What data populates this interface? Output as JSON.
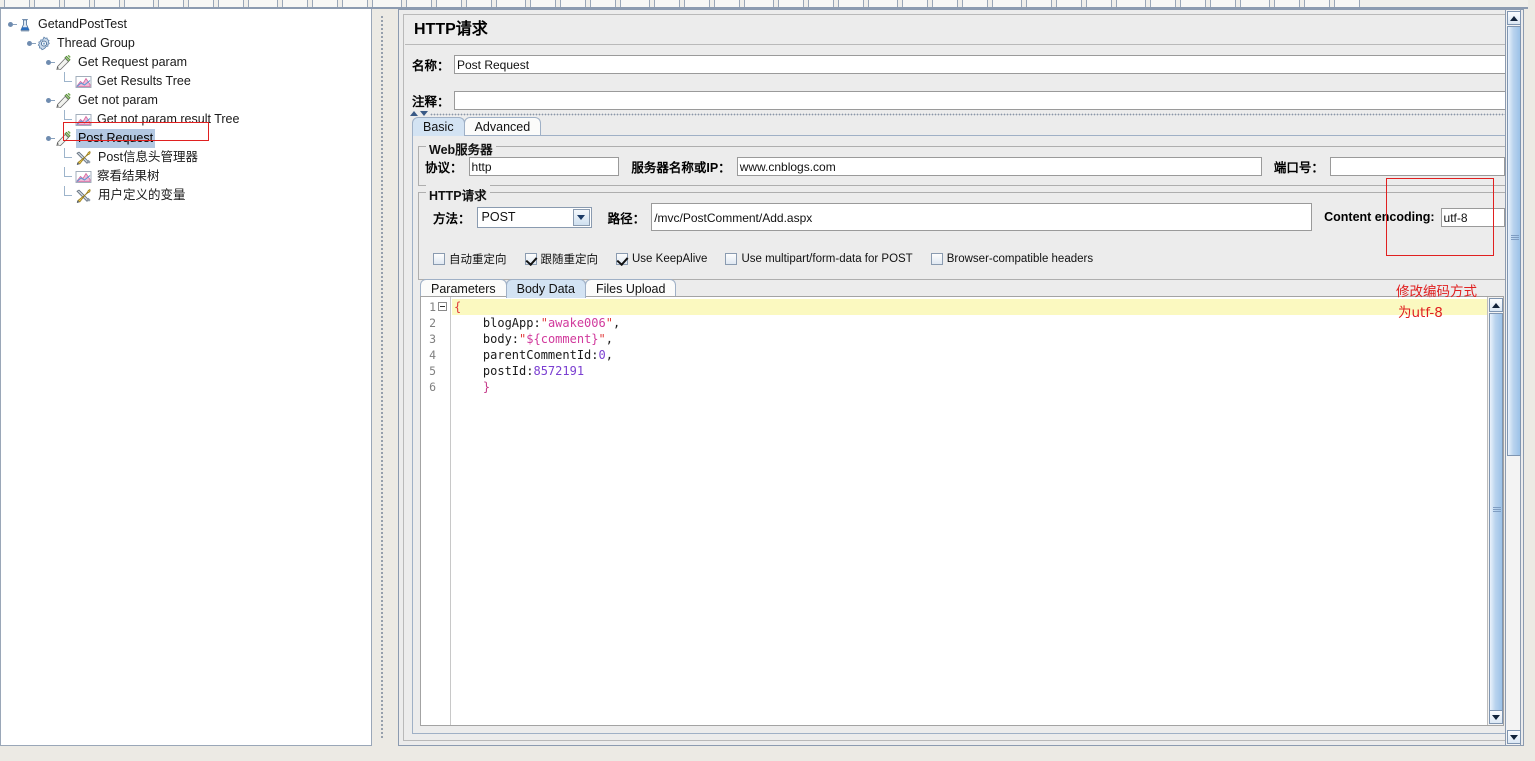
{
  "tree": {
    "name": "test-plan-tree",
    "nodes": [
      {
        "label": "GetandPostTest",
        "icon": "test-plan-icon",
        "depth": 0,
        "selected": false
      },
      {
        "label": "Thread Group",
        "icon": "thread-group-icon",
        "depth": 1,
        "selected": false
      },
      {
        "label": "Get Request param",
        "icon": "http-sampler-icon",
        "depth": 2,
        "selected": false
      },
      {
        "label": "Get Results Tree",
        "icon": "listener-icon",
        "depth": 3,
        "selected": false
      },
      {
        "label": "Get not param",
        "icon": "http-sampler-icon",
        "depth": 2,
        "selected": false
      },
      {
        "label": "Get not param result Tree",
        "icon": "listener-icon",
        "depth": 3,
        "selected": false
      },
      {
        "label": "Post Request",
        "icon": "http-sampler-icon",
        "depth": 2,
        "selected": true
      },
      {
        "label": "Post信息头管理器",
        "icon": "config-icon",
        "depth": 3,
        "selected": false
      },
      {
        "label": "察看结果树",
        "icon": "listener-icon",
        "depth": 3,
        "selected": false
      },
      {
        "label": "用户定义的变量",
        "icon": "config-icon",
        "depth": 3,
        "selected": false
      }
    ]
  },
  "panel": {
    "title": "HTTP请求",
    "name_label": "名称：",
    "name_value": "Post Request",
    "comment_label": "注释：",
    "comment_value": "",
    "tabs": [
      {
        "label": "Basic",
        "active": true
      },
      {
        "label": "Advanced",
        "active": false
      }
    ],
    "webserver": {
      "group_title": "Web服务器",
      "protocol_label": "协议：",
      "protocol_value": "http",
      "server_label": "服务器名称或IP：",
      "server_value": "www.cnblogs.com",
      "port_label": "端口号：",
      "port_value": ""
    },
    "httprequest": {
      "group_title": "HTTP请求",
      "method_label": "方法：",
      "method_value": "POST",
      "path_label": "路径：",
      "path_value": "/mvc/PostComment/Add.aspx",
      "encoding_label": "Content encoding:",
      "encoding_value": "utf-8"
    },
    "options": [
      {
        "label": "自动重定向",
        "checked": false
      },
      {
        "label": "跟随重定向",
        "checked": true
      },
      {
        "label": "Use KeepAlive",
        "checked": true
      },
      {
        "label": "Use multipart/form-data for POST",
        "checked": false
      },
      {
        "label": "Browser-compatible headers",
        "checked": false
      }
    ],
    "body_tabs": [
      {
        "label": "Parameters",
        "active": false
      },
      {
        "label": "Body Data",
        "active": true
      },
      {
        "label": "Files Upload",
        "active": false
      }
    ],
    "editor": {
      "line_numbers": [
        "1",
        "2",
        "3",
        "4",
        "5",
        "6"
      ],
      "lines": [
        {
          "indent": 0,
          "tokens": [
            {
              "t": "{",
              "c": "brace"
            }
          ],
          "highlight": true
        },
        {
          "indent": 4,
          "tokens": [
            {
              "t": "blogApp:",
              "c": "key"
            },
            {
              "t": "\"",
              "c": "str"
            },
            {
              "t": "awake006",
              "c": "strval"
            },
            {
              "t": "\"",
              "c": "str"
            },
            {
              "t": ",",
              "c": "punc"
            }
          ],
          "highlight": false
        },
        {
          "indent": 4,
          "tokens": [
            {
              "t": "body:",
              "c": "key"
            },
            {
              "t": "\"",
              "c": "str"
            },
            {
              "t": "${comment}",
              "c": "strval"
            },
            {
              "t": "\"",
              "c": "str"
            },
            {
              "t": ",",
              "c": "punc"
            }
          ],
          "highlight": false
        },
        {
          "indent": 4,
          "tokens": [
            {
              "t": "parentCommentId:",
              "c": "key"
            },
            {
              "t": "0",
              "c": "num"
            },
            {
              "t": ",",
              "c": "punc"
            }
          ],
          "highlight": false
        },
        {
          "indent": 4,
          "tokens": [
            {
              "t": "postId:",
              "c": "key"
            },
            {
              "t": "8572191",
              "c": "num"
            }
          ],
          "highlight": false
        },
        {
          "indent": 4,
          "tokens": [
            {
              "t": "}",
              "c": "brace2"
            }
          ],
          "highlight": false
        }
      ]
    }
  },
  "annotation": {
    "line1": "修改编码方式",
    "line2": "为utf-8",
    "color": "#e02020"
  },
  "colors": {
    "selection": "#b3c8e2",
    "annotation_red": "#e02020",
    "tab_active": "#d3e3f3",
    "editor_highlight": "#fbf9c0",
    "string_value": "#d1399c",
    "number_value": "#7b3fd1",
    "quote": "#e03a3a",
    "panel_bg": "#ececec"
  }
}
